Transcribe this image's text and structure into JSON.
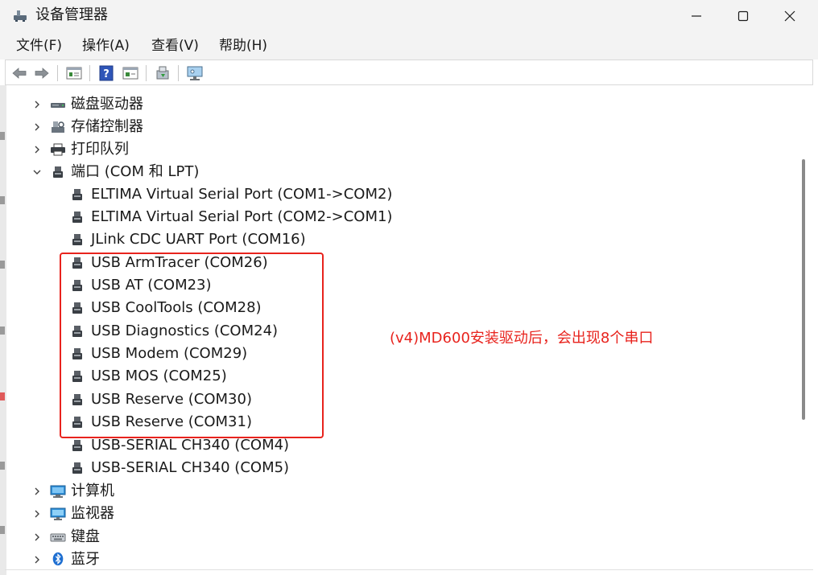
{
  "window": {
    "title": "设备管理器",
    "controls": [
      "minimize",
      "maximize",
      "close"
    ]
  },
  "menu": [
    {
      "label": "文件(F)"
    },
    {
      "label": "操作(A)"
    },
    {
      "label": "查看(V)"
    },
    {
      "label": "帮助(H)"
    }
  ],
  "toolbar": {
    "buttons": [
      "back-arrow-icon",
      "forward-arrow-icon",
      "properties-icon",
      "help-icon",
      "view-icon",
      "update-driver-icon",
      "monitor-scan-icon"
    ]
  },
  "tree": {
    "categories": [
      {
        "label": "磁盘驱动器",
        "icon": "disk-drive-icon",
        "expanded": false
      },
      {
        "label": "存储控制器",
        "icon": "storage-controller-icon",
        "expanded": false
      },
      {
        "label": "打印队列",
        "icon": "printer-icon",
        "expanded": false
      },
      {
        "label": "端口 (COM 和 LPT)",
        "icon": "port-icon",
        "expanded": true
      }
    ],
    "ports": [
      {
        "label": "ELTIMA Virtual Serial Port (COM1->COM2)"
      },
      {
        "label": "ELTIMA Virtual Serial Port (COM2->COM1)"
      },
      {
        "label": "JLink CDC UART Port (COM16)"
      },
      {
        "label": "USB ArmTracer (COM26)"
      },
      {
        "label": "USB AT (COM23)"
      },
      {
        "label": "USB CoolTools (COM28)"
      },
      {
        "label": "USB Diagnostics (COM24)"
      },
      {
        "label": "USB Modem (COM29)"
      },
      {
        "label": "USB MOS (COM25)"
      },
      {
        "label": "USB Reserve (COM30)"
      },
      {
        "label": "USB Reserve (COM31)"
      },
      {
        "label": "USB-SERIAL CH340 (COM4)"
      },
      {
        "label": "USB-SERIAL CH340 (COM5)"
      }
    ],
    "more_categories": [
      {
        "label": "计算机",
        "icon": "computer-icon"
      },
      {
        "label": "监视器",
        "icon": "monitor-icon"
      },
      {
        "label": "键盘",
        "icon": "keyboard-icon"
      },
      {
        "label": "蓝牙",
        "icon": "bluetooth-icon"
      }
    ]
  },
  "annotation": {
    "text": "(v4)MD600安装驱动后，会出现8个串口",
    "color": "#e8231d"
  }
}
